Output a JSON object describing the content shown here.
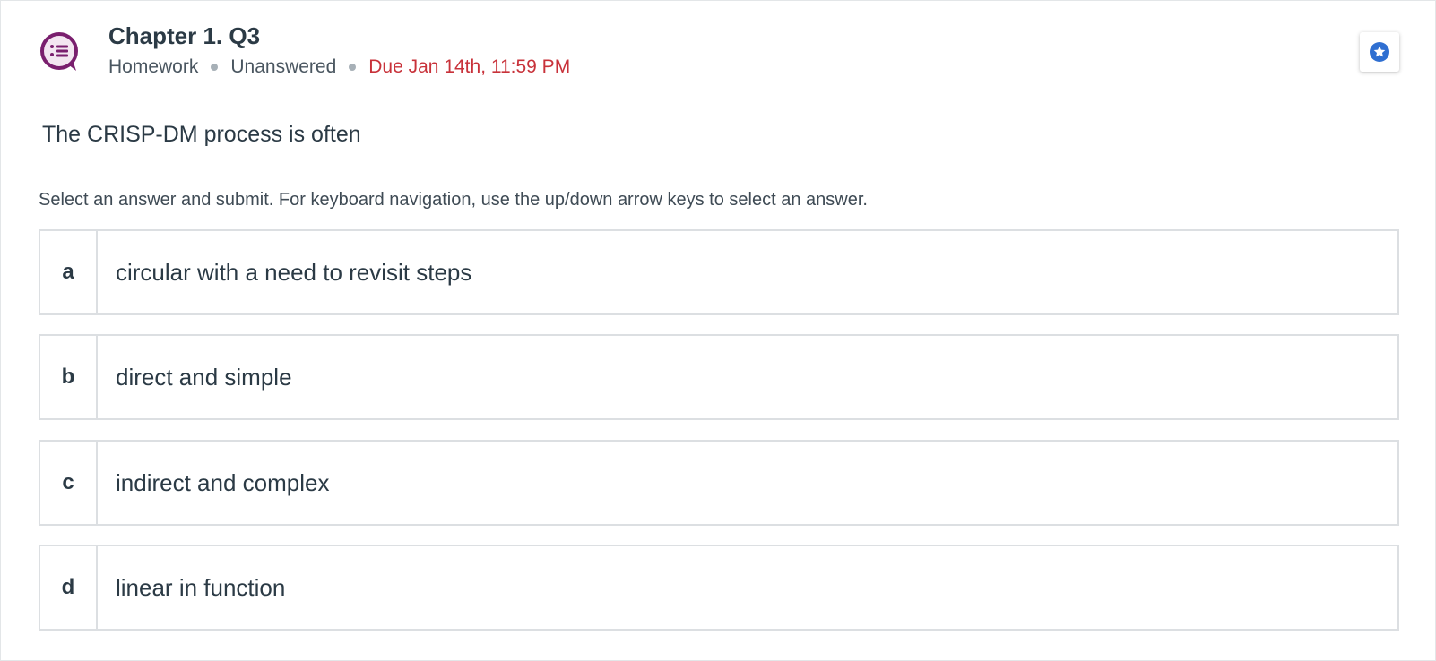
{
  "header": {
    "title": "Chapter 1. Q3",
    "type": "Homework",
    "status": "Unanswered",
    "due": "Due Jan 14th, 11:59 PM"
  },
  "question": {
    "text": "The CRISP-DM process is often",
    "instructions": "Select an answer and submit. For keyboard navigation, use the up/down arrow keys to select an answer."
  },
  "options": [
    {
      "letter": "a",
      "text": "circular with a need to revisit steps"
    },
    {
      "letter": "b",
      "text": "direct and simple"
    },
    {
      "letter": "c",
      "text": "indirect and complex"
    },
    {
      "letter": "d",
      "text": "linear in function"
    }
  ],
  "icons": {
    "question": "question-chat-icon",
    "bookmark": "star-bookmark-icon"
  },
  "colors": {
    "accent": "#7a1f6e",
    "due": "#c8323a",
    "bookmark": "#2f6fd1"
  }
}
